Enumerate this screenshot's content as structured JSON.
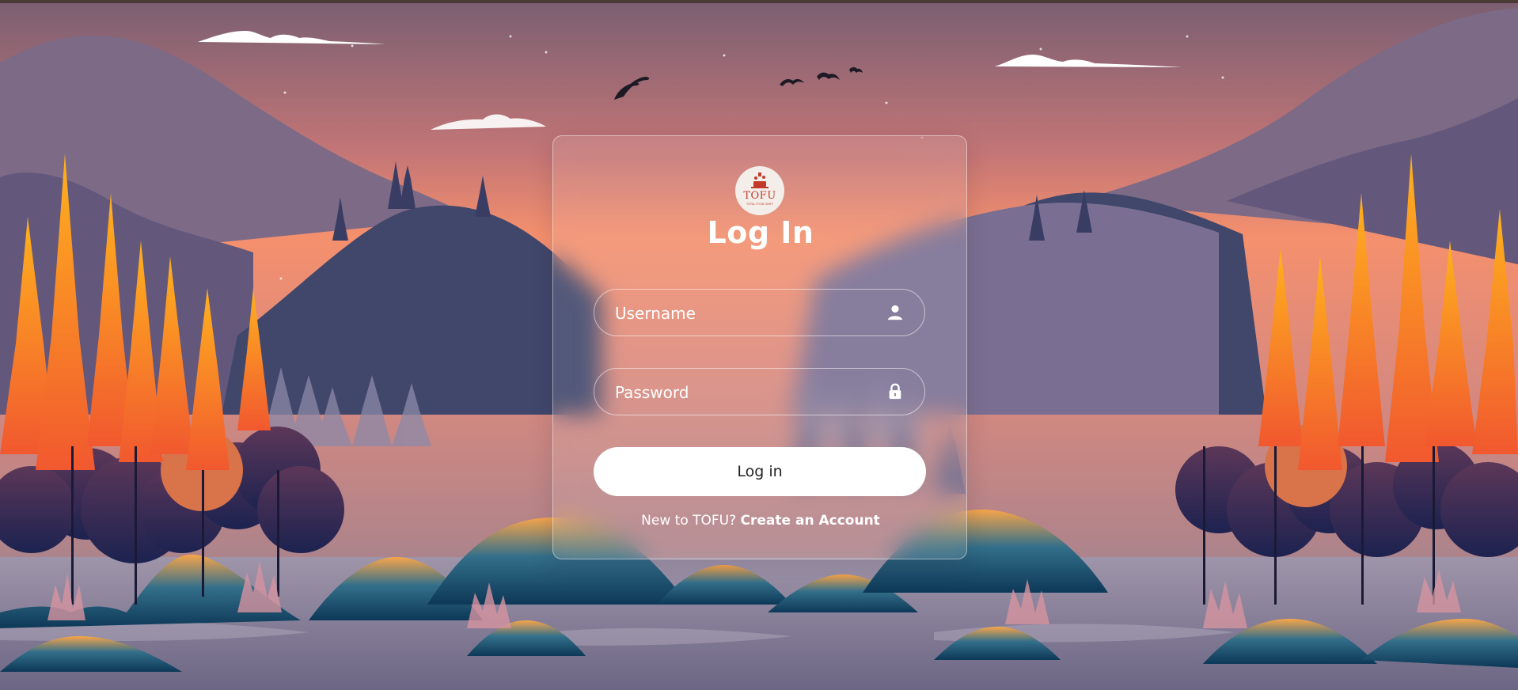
{
  "login": {
    "logo_text": "TOFU",
    "logo_subtext": "TOTAL FOOD UNITY",
    "title": "Log In",
    "username_placeholder": "Username",
    "password_placeholder": "Password",
    "submit_label": "Log in",
    "signup_prompt": "New to TOFU?",
    "signup_link": "Create an Account"
  },
  "icons": {
    "username": "user-icon",
    "password": "lock-icon"
  },
  "colors": {
    "sky_top": "#7d6170",
    "sky_glow": "#f58d6d",
    "button_bg": "#ffffff",
    "text": "#ffffff"
  }
}
